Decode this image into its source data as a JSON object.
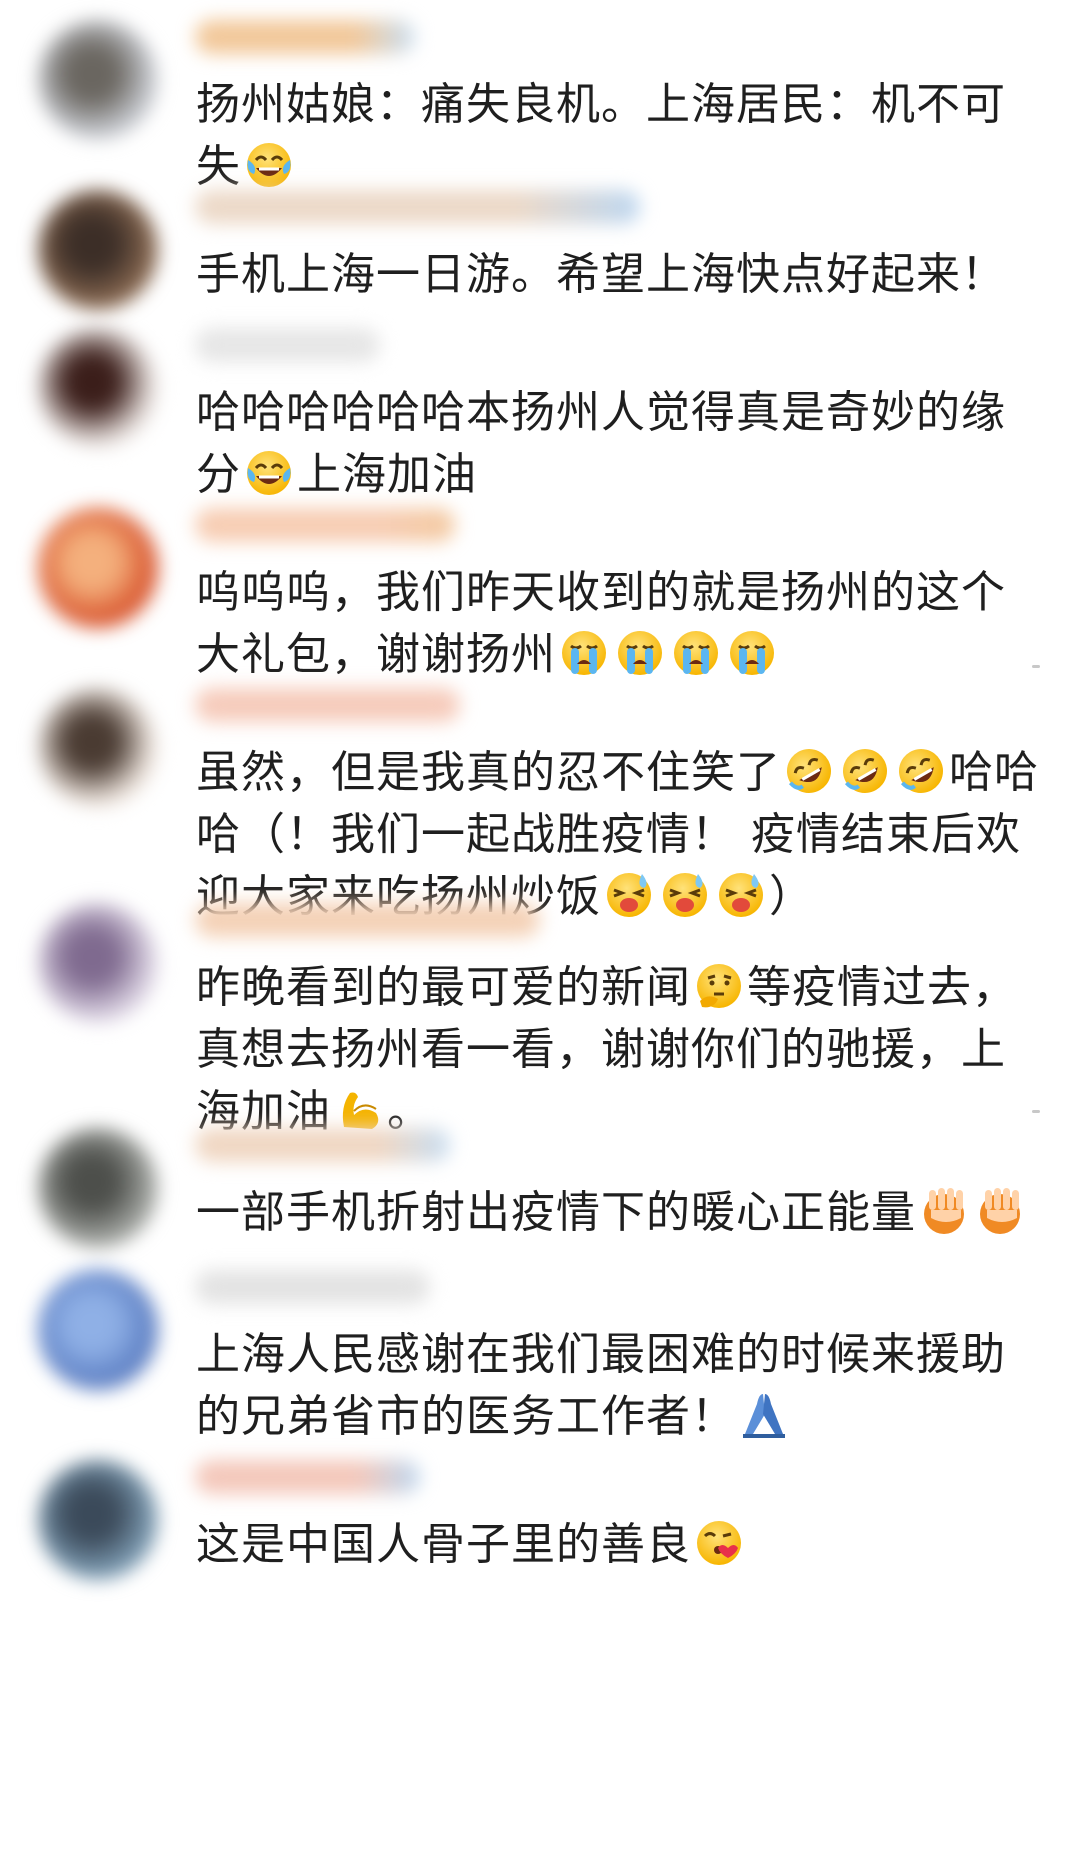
{
  "comments": [
    {
      "avatar_colors": [
        "#c9ccd2",
        "#6a6660"
      ],
      "name_bar_color": "#f2c89a",
      "name_bar_accent": "#c9dff3",
      "segments": [
        {
          "t": "text",
          "v": "扬州姑娘：痛失良机。上海居民：机不可失"
        },
        {
          "t": "emoji",
          "icon": "tears-of-joy-emoji"
        }
      ]
    },
    {
      "avatar_colors": [
        "#8a6a52",
        "#3c2e27"
      ],
      "name_bar_color": "#ecd9c8",
      "name_bar_accent": "#bcd6f0",
      "segments": [
        {
          "t": "text",
          "v": "手机上海一日游。希望上海快点好起来！"
        }
      ]
    },
    {
      "avatar_colors": [
        "#e9e2df",
        "#3b1e1a"
      ],
      "name_bar_color": "#e6e6e6",
      "name_bar_accent": "#e6e6e6",
      "segments": [
        {
          "t": "text",
          "v": "哈哈哈哈哈哈本扬州人觉得真是奇妙的缘分"
        },
        {
          "t": "emoji",
          "icon": "tears-of-joy-emoji"
        },
        {
          "t": "text",
          "v": "上海加油"
        }
      ]
    },
    {
      "avatar_colors": [
        "#d8552e",
        "#f4b07d"
      ],
      "name_bar_color": "#f7cdb3",
      "name_bar_accent": "#f3c9a0",
      "segments": [
        {
          "t": "text",
          "v": "呜呜呜，我们昨天收到的就是扬州的这个大礼包，谢谢扬州"
        },
        {
          "t": "emoji",
          "icon": "crying-emoji"
        },
        {
          "t": "emoji",
          "icon": "crying-emoji"
        },
        {
          "t": "emoji",
          "icon": "crying-emoji"
        },
        {
          "t": "emoji",
          "icon": "crying-emoji"
        }
      ]
    },
    {
      "avatar_colors": [
        "#efe6df",
        "#4a3b32"
      ],
      "name_bar_color": "#f6cbbb",
      "name_bar_accent": "#f6cbbb",
      "segments": [
        {
          "t": "text",
          "v": "虽然，但是我真的忍不住笑了"
        },
        {
          "t": "emoji",
          "icon": "rolling-laughing-emoji"
        },
        {
          "t": "emoji",
          "icon": "rolling-laughing-emoji"
        },
        {
          "t": "emoji",
          "icon": "rolling-laughing-emoji"
        },
        {
          "t": "text",
          "v": "哈哈哈（！我们一起战胜疫情！ 疫情结束后欢迎大家来吃扬州炒饭"
        },
        {
          "t": "emoji",
          "icon": "sweat-laugh-emoji"
        },
        {
          "t": "emoji",
          "icon": "sweat-laugh-emoji"
        },
        {
          "t": "emoji",
          "icon": "sweat-laugh-emoji"
        },
        {
          "t": "text",
          "v": "）"
        }
      ]
    },
    {
      "avatar_colors": [
        "#ddd5e4",
        "#7f6a8f"
      ],
      "name_bar_color": "#f4d1b6",
      "name_bar_accent": "#f4d1b6",
      "segments": [
        {
          "t": "text",
          "v": "昨晚看到的最可爱的新闻"
        },
        {
          "t": "emoji",
          "icon": "thinking-emoji"
        },
        {
          "t": "text",
          "v": "等疫情过去，真想去扬州看一看，谢谢你们的驰援，上海加油"
        },
        {
          "t": "emoji",
          "icon": "flexed-biceps-emoji"
        },
        {
          "t": "text",
          "v": "。"
        }
      ]
    },
    {
      "avatar_colors": [
        "#a7aaa6",
        "#4d4f4b"
      ],
      "name_bar_color": "#f0d7c3",
      "name_bar_accent": "#c6ddf2",
      "segments": [
        {
          "t": "text",
          "v": "一部手机折射出疫情下的暖心正能量"
        },
        {
          "t": "emoji",
          "icon": "peace-hands-emoji"
        },
        {
          "t": "emoji",
          "icon": "peace-hands-emoji"
        }
      ]
    },
    {
      "avatar_colors": [
        "#5d7fc3",
        "#8fb0e6"
      ],
      "name_bar_color": "#e3e3e3",
      "name_bar_accent": "#e3e3e3",
      "segments": [
        {
          "t": "text",
          "v": "上海人民感谢在我们最困难的时候来援助的兄弟省市的医务工作者！"
        },
        {
          "t": "emoji",
          "icon": "folded-hands-emoji"
        }
      ]
    },
    {
      "avatar_colors": [
        "#7f9eb5",
        "#3b4a5a"
      ],
      "name_bar_color": "#f4c8bb",
      "name_bar_accent": "#bcd7f0",
      "segments": [
        {
          "t": "text",
          "v": "这是中国人骨子里的善良"
        },
        {
          "t": "emoji",
          "icon": "blowing-kiss-emoji"
        }
      ]
    }
  ]
}
